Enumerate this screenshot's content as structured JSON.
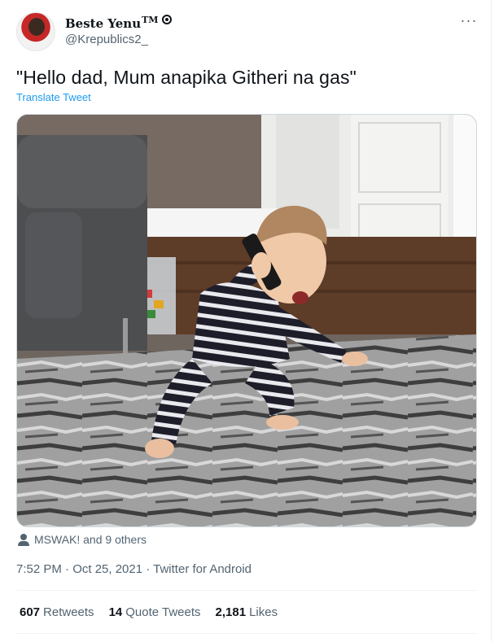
{
  "tweet": {
    "display_name": "Beste Yenu",
    "display_name_suffix": "TM",
    "handle": "@Krepublics2_",
    "text": "\"Hello dad, Mum anapika Githeri na gas\"",
    "translate_label": "Translate Tweet",
    "liked_by": "MSWAK! and 9 others",
    "timestamp": "7:52 PM · Oct 25, 2021 · Twitter for Android",
    "more_icon": "···"
  },
  "stats": [
    {
      "count": "607",
      "label": "Retweets"
    },
    {
      "count": "14",
      "label": "Quote Tweets"
    },
    {
      "count": "2,181",
      "label": "Likes"
    }
  ],
  "icons": {
    "more": "more-horizontal-icon",
    "liked_by": "person-icon",
    "badge": "verified-circle-icon"
  },
  "colors": {
    "link": "#1d9bf0",
    "secondary_text": "#536471",
    "primary_text": "#0f1419"
  }
}
